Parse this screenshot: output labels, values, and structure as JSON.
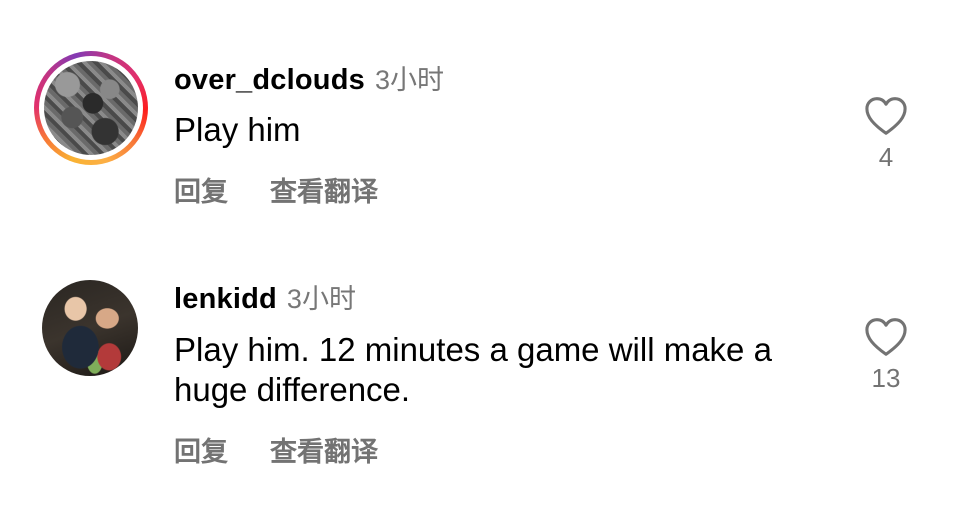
{
  "comments": [
    {
      "username": "over_dclouds",
      "time": "3小时",
      "text": "Play him",
      "reply_label": "回复",
      "translate_label": "查看翻译",
      "likes": "4",
      "avatar_has_story_ring": true
    },
    {
      "username": "lenkidd",
      "time": "3小时",
      "text": "Play him.  12 minutes a game will make a huge difference.",
      "reply_label": "回复",
      "translate_label": "查看翻译",
      "likes": "13",
      "avatar_has_story_ring": false
    }
  ],
  "icons": {
    "like": "heart-outline-icon"
  },
  "colors": {
    "secondary_text": "#737373",
    "story_ring_start": "#f9b233",
    "story_ring_end": "#c13584"
  }
}
